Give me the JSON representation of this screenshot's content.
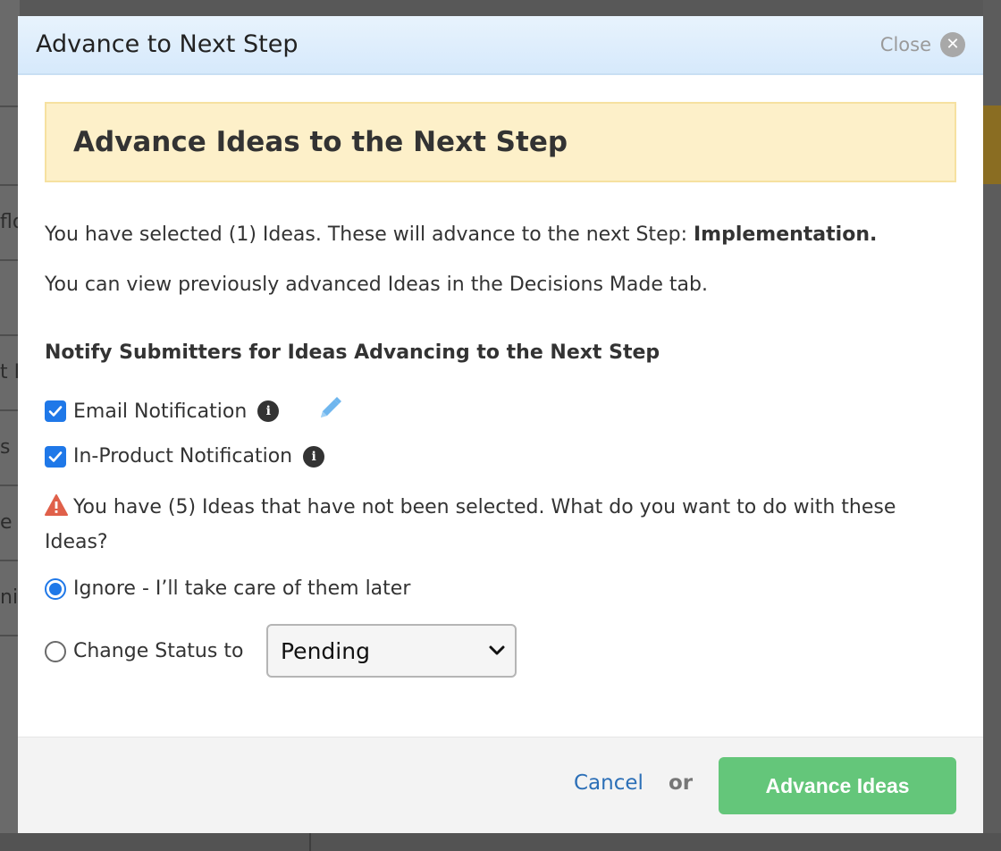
{
  "background": {
    "fragments": [
      "flo",
      "t L",
      "s",
      "e s",
      "nie"
    ]
  },
  "modal": {
    "title": "Advance to Next Step",
    "close_label": "Close",
    "banner_title": "Advance Ideas to the Next Step",
    "selected_text": "You have selected (1) Ideas. These will advance to the next Step: ",
    "next_step_name": "Implementation.",
    "view_text": "You can view previously advanced Ideas in the Decisions Made tab.",
    "notify_heading": "Notify Submitters for Ideas Advancing to the Next Step",
    "email_notification_label": "Email Notification",
    "email_notification_checked": true,
    "in_product_notification_label": "In-Product Notification",
    "in_product_notification_checked": true,
    "warning_text": "You have (5) Ideas that have not been selected. What do you want to do with these Ideas?",
    "option_ignore_label": "Ignore - I’ll take care of them later",
    "option_change_status_label": "Change Status to",
    "selected_option": "ignore",
    "status_select_value": "Pending",
    "cancel_label": "Cancel",
    "or_label": "or",
    "advance_label": "Advance Ideas"
  },
  "colors": {
    "accent_blue": "#1f78e8",
    "banner_bg": "#fdf0c9",
    "primary_button": "#64c67a",
    "link": "#2c6fb7",
    "warning": "#e0604a"
  }
}
